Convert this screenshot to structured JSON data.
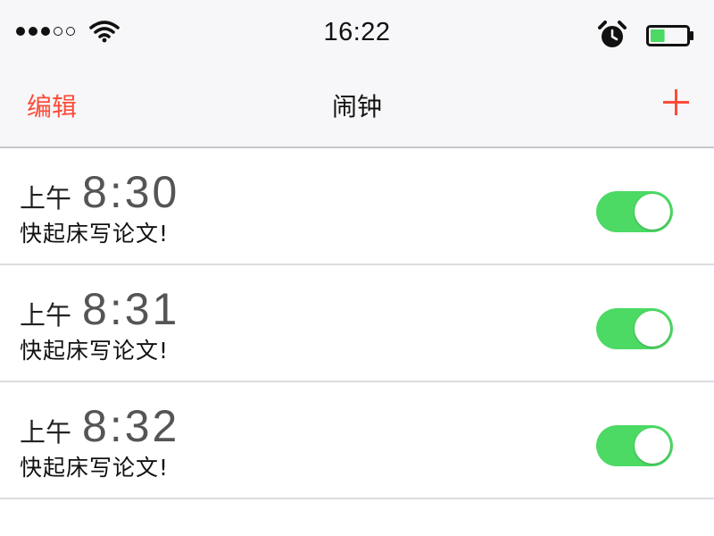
{
  "status_bar": {
    "time": "16:22",
    "signal_dots": [
      true,
      true,
      true,
      false,
      false
    ],
    "icons": [
      "signal-dots-icon",
      "wifi-icon",
      "alarm-clock-icon",
      "battery-icon"
    ],
    "battery_level_percent": 40,
    "battery_color": "#4cd964"
  },
  "nav": {
    "edit_label": "编辑",
    "title": "闹钟",
    "add_icon": "plus-icon",
    "accent_color": "#ff4b39"
  },
  "alarms": [
    {
      "period": "上午",
      "time": "8:30",
      "label": "快起床写论文!",
      "enabled": true
    },
    {
      "period": "上午",
      "time": "8:31",
      "label": "快起床写论文!",
      "enabled": true
    },
    {
      "period": "上午",
      "time": "8:32",
      "label": "快起床写论文!",
      "enabled": true
    }
  ],
  "toggle_on_color": "#4cd964"
}
